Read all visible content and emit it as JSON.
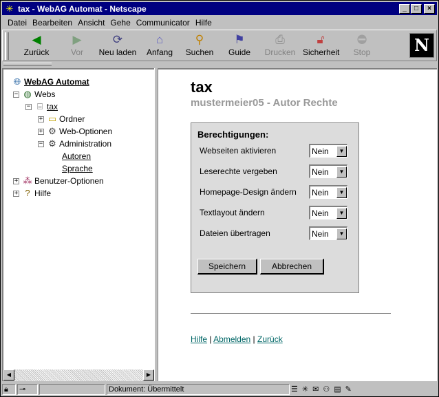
{
  "window": {
    "title": "tax - WebAG Automat - Netscape",
    "minimize_label": "_",
    "maximize_label": "□",
    "close_label": "×"
  },
  "menu": [
    "Datei",
    "Bearbeiten",
    "Ansicht",
    "Gehe",
    "Communicator",
    "Hilfe"
  ],
  "toolbar": {
    "back": "Zurück",
    "forward": "Vor",
    "reload": "Neu laden",
    "home": "Anfang",
    "search": "Suchen",
    "guide": "Guide",
    "print": "Drucken",
    "security": "Sicherheit",
    "stop": "Stop"
  },
  "tree": {
    "root": "WebAG Automat",
    "webs": "Webs",
    "tax": "tax",
    "ordner": "Ordner",
    "web_optionen": "Web-Optionen",
    "administration": "Administration",
    "autoren": "Autoren",
    "sprache": "Sprache",
    "benutzer_optionen": "Benutzer-Optionen",
    "hilfe": "Hilfe",
    "expand": "+",
    "collapse": "−"
  },
  "main": {
    "title": "tax",
    "subtitle": "mustermeier05 - Autor Rechte",
    "permissions_heading": "Berechtigungen:",
    "permissions": [
      {
        "label": "Webseiten aktivieren",
        "value": "Nein"
      },
      {
        "label": "Leserechte vergeben",
        "value": "Nein"
      },
      {
        "label": "Homepage-Design ändern",
        "value": "Nein"
      },
      {
        "label": "Textlayout ändern",
        "value": "Nein"
      },
      {
        "label": "Dateien übertragen",
        "value": "Nein"
      }
    ],
    "save_button": "Speichern",
    "cancel_button": "Abbrechen",
    "links": {
      "help": "Hilfe",
      "logout": "Abmelden",
      "back": "Zurück",
      "separator": "|"
    }
  },
  "statusbar": {
    "text": "Dokument: Übermittelt"
  },
  "colors": {
    "titlebar": "#000080",
    "link": "#006666",
    "subtitle": "#999999"
  }
}
